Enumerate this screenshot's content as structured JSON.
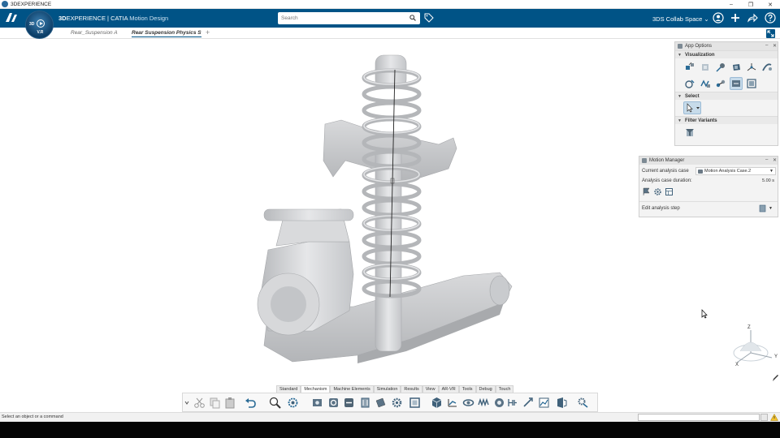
{
  "window": {
    "title": "3DEXPERIENCE",
    "minimize": "–",
    "maximize": "❐",
    "close": "✕"
  },
  "header": {
    "brand_bold": "3D",
    "brand_main": "EXPERIENCE | ",
    "brand_catia": "CATIA",
    "brand_app": " Motion Design",
    "search_placeholder": "Search",
    "collab_space": "3DS Collab Space",
    "colors": {
      "header_bg": "#005386"
    }
  },
  "compass": {
    "label_3d": "3D",
    "version": "V.R"
  },
  "tabs": [
    {
      "label": "Rear_Suspension A",
      "active": false
    },
    {
      "label": "Rear Suspension Physics St",
      "active": true
    }
  ],
  "tab_add": "+",
  "app_options": {
    "title": "App Options",
    "sections": [
      {
        "label": "Visualization",
        "icons": [
          "explode-icon",
          "render-icon",
          "measure-icon",
          "shading-icon",
          "axis-icon",
          "link-icon",
          "view-icon",
          "spring-icon",
          "joint-icon",
          "motion-icon",
          "dynamic-icon"
        ]
      },
      {
        "label": "Select",
        "icons": [
          "select-arrow-icon"
        ]
      },
      {
        "label": "Filter Variants",
        "icons": [
          "filter-icon"
        ]
      }
    ]
  },
  "motion_manager": {
    "title": "Motion Manager",
    "current_case_label": "Current analysis case",
    "current_case_value": "Motion Analysis Case.2",
    "duration_label": "Analysis case duration:",
    "duration_value": "5.00 s",
    "edit_step_label": "Edit analysis step"
  },
  "toolbar": {
    "tabs": [
      "Standard",
      "Mechanism",
      "Machine Elements",
      "Simulation",
      "Results",
      "View",
      "AR-VR",
      "Tools",
      "Debug",
      "Touch"
    ],
    "active_tab": "Mechanism"
  },
  "axes": {
    "z": "Z",
    "y": "Y",
    "x": "X"
  },
  "status": {
    "text": "Select an object or a command"
  }
}
